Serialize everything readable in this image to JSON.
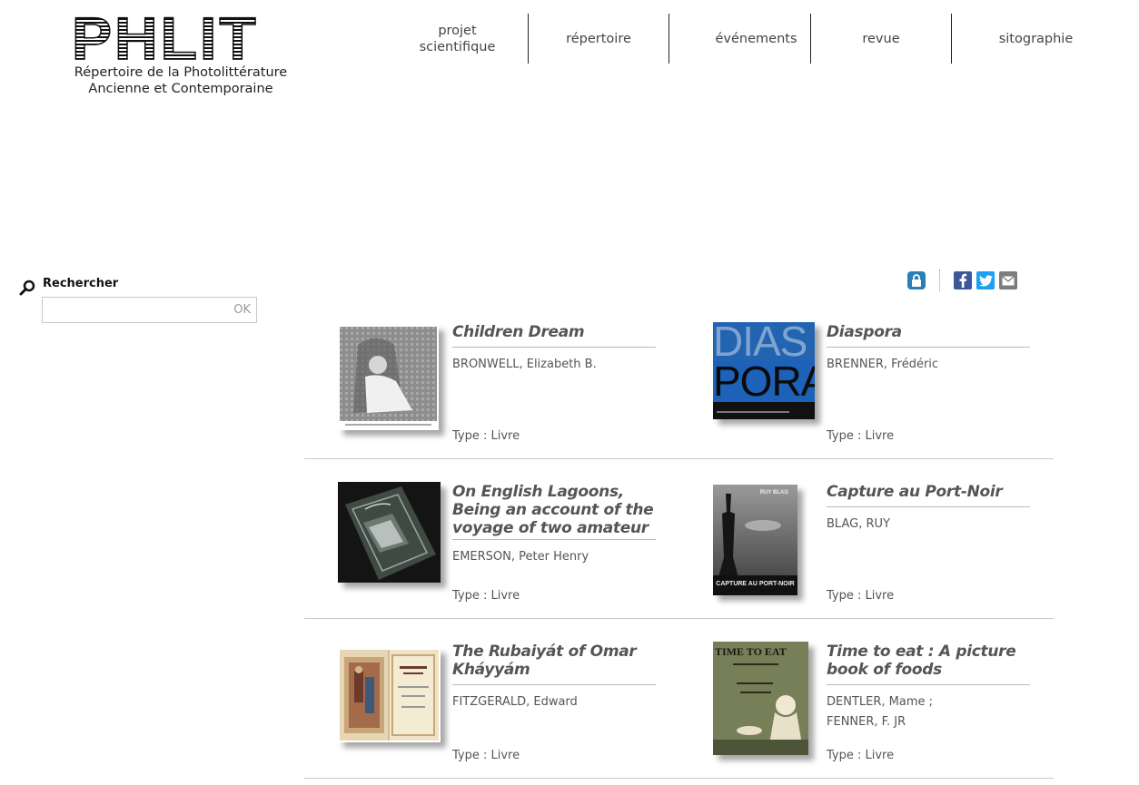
{
  "header": {
    "logo_text": "PHLIT",
    "logo_sub_line1": "Répertoire de la Photolittérature",
    "logo_sub_line2": "Ancienne et Contemporaine"
  },
  "nav": {
    "items": [
      {
        "label": "projet scientifique"
      },
      {
        "label": "répertoire"
      },
      {
        "label": "événements"
      },
      {
        "label": "revue"
      },
      {
        "label": "sitographie"
      }
    ]
  },
  "search": {
    "label": "Rechercher",
    "placeholder": "",
    "value": "",
    "ok_label": "OK"
  },
  "share": {
    "icons": [
      "lock-icon",
      "facebook-icon",
      "twitter-icon",
      "email-icon"
    ]
  },
  "colors": {
    "facebook": "#3b5998",
    "twitter": "#1da1f2",
    "email": "#7d7d7d",
    "lock": "#2b7fb8"
  },
  "results": [
    {
      "title": "Children Dream",
      "author": "BRONWELL, Elizabeth B.",
      "type": "Type : Livre",
      "thumb_caption": ""
    },
    {
      "title": "Diaspora",
      "author": "BRENNER, Frédéric",
      "type": "Type : Livre",
      "thumb_text_top": "DIAS",
      "thumb_text_bottom": "PORA"
    },
    {
      "title": "On English Lagoons, Being an account of the voyage of two amateur",
      "author": "EMERSON, Peter Henry",
      "type": "Type : Livre"
    },
    {
      "title": "Capture au Port-Noir",
      "author": "BLAG, RUY",
      "type": "Type : Livre",
      "thumb_text_top": "RUY BLAG",
      "thumb_text_bottom": "CAPTURE AU PORT-NOIR"
    },
    {
      "title": "The Rubaiyát of Omar Kháyyám",
      "author": "FITZGERALD, Edward",
      "type": "Type : Livre"
    },
    {
      "title": "Time to eat : A picture book of foods",
      "author_line1": "DENTLER, Mame ;",
      "author_line2": "FENNER, F. JR",
      "type": "Type : Livre",
      "thumb_text_top": "TIME TO EAT"
    }
  ]
}
